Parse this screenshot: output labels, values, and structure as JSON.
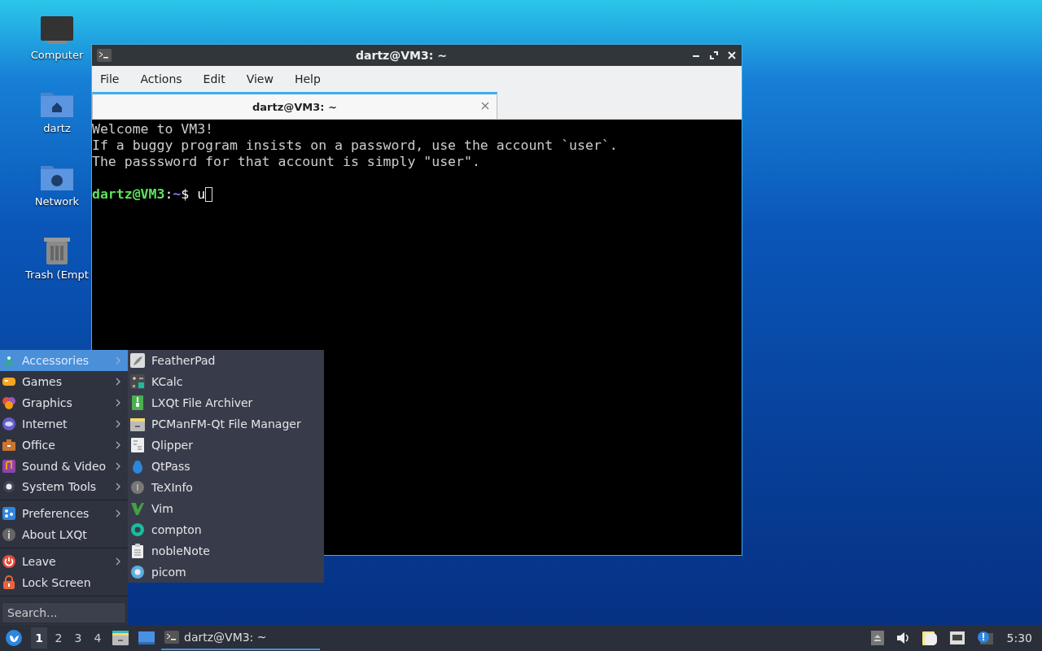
{
  "desktop_icons": [
    {
      "label": "Computer",
      "kind": "computer"
    },
    {
      "label": "dartz",
      "kind": "home"
    },
    {
      "label": "Network",
      "kind": "network"
    },
    {
      "label": "Trash (Empt",
      "kind": "trash"
    }
  ],
  "terminal": {
    "title": "dartz@VM3: ~",
    "menu": [
      "File",
      "Actions",
      "Edit",
      "View",
      "Help"
    ],
    "tabs": [
      {
        "label": "dartz@VM3: ~",
        "selected": true
      }
    ],
    "lines": [
      "Welcome to VM3!",
      "If a buggy program insists on a password, use the account `user`.",
      "The passsword for that account is simply \"user\"."
    ],
    "prompt": {
      "user_host": "dartz@VM3",
      "separator": ":",
      "path": "~",
      "symbol": "$",
      "input": "u"
    }
  },
  "start_menu": {
    "groups": [
      [
        {
          "label": "Accessories",
          "selected": true,
          "submenu": true
        },
        {
          "label": "Games",
          "selected": false,
          "submenu": true
        },
        {
          "label": "Graphics",
          "selected": false,
          "submenu": true
        },
        {
          "label": "Internet",
          "selected": false,
          "submenu": true
        },
        {
          "label": "Office",
          "selected": false,
          "submenu": true
        },
        {
          "label": "Sound & Video",
          "selected": false,
          "submenu": true
        },
        {
          "label": "System Tools",
          "selected": false,
          "submenu": true
        }
      ],
      [
        {
          "label": "Preferences",
          "selected": false,
          "submenu": true
        },
        {
          "label": "About LXQt",
          "selected": false,
          "submenu": false
        }
      ],
      [
        {
          "label": "Leave",
          "selected": false,
          "submenu": true
        },
        {
          "label": "Lock Screen",
          "selected": false,
          "submenu": false
        }
      ]
    ],
    "search": {
      "placeholder": "Search..."
    },
    "submenu": [
      "FeatherPad",
      "KCalc",
      "LXQt File Archiver",
      "PCManFM-Qt File Manager",
      "Qlipper",
      "QtPass",
      "TeXInfo",
      "Vim",
      "compton",
      "nobleNote",
      "picom"
    ]
  },
  "taskbar": {
    "desktops": [
      {
        "label": "1",
        "selected": true
      },
      {
        "label": "2",
        "selected": false
      },
      {
        "label": "3",
        "selected": false
      },
      {
        "label": "4",
        "selected": false
      }
    ],
    "tasks": [
      {
        "title": "dartz@VM3: ~",
        "selected": true
      }
    ],
    "clock": "5:30"
  }
}
